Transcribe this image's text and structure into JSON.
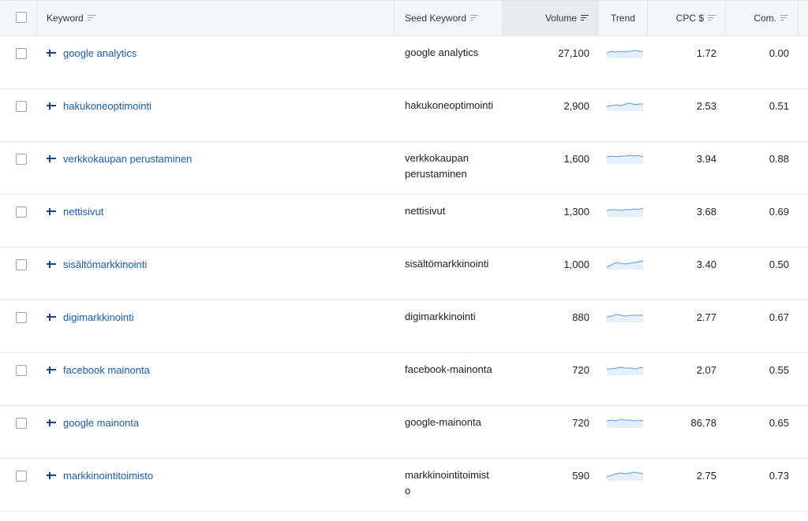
{
  "columns": {
    "keyword": "Keyword",
    "seed": "Seed Keyword",
    "volume": "Volume",
    "trend": "Trend",
    "cpc": "CPC $",
    "com": "Com."
  },
  "rows": [
    {
      "keyword": "google analytics",
      "seed": "google analytics",
      "volume": "27,100",
      "cpc": "1.72",
      "com": "0.00"
    },
    {
      "keyword": "hakukoneoptimointi",
      "seed": "hakukoneoptimointi",
      "volume": "2,900",
      "cpc": "2.53",
      "com": "0.51"
    },
    {
      "keyword": "verkkokaupan perustaminen",
      "seed": "verkkokaupan perustaminen",
      "volume": "1,600",
      "cpc": "3.94",
      "com": "0.88"
    },
    {
      "keyword": "nettisivut",
      "seed": "nettisivut",
      "volume": "1,300",
      "cpc": "3.68",
      "com": "0.69"
    },
    {
      "keyword": "sisältömarkkinointi",
      "seed": "sisältömarkkinointi",
      "volume": "1,000",
      "cpc": "3.40",
      "com": "0.50"
    },
    {
      "keyword": "digimarkkinointi",
      "seed": "digimarkkinointi",
      "volume": "880",
      "cpc": "2.77",
      "com": "0.67"
    },
    {
      "keyword": "facebook mainonta",
      "seed": "facebook-mainonta",
      "volume": "720",
      "cpc": "2.07",
      "com": "0.55"
    },
    {
      "keyword": "google mainonta",
      "seed": "google-mainonta",
      "volume": "720",
      "cpc": "86.78",
      "com": "0.65"
    },
    {
      "keyword": "markkinointitoimisto",
      "seed": "markkinointitoimisto",
      "volume": "590",
      "cpc": "2.75",
      "com": "0.73"
    }
  ],
  "colors": {
    "link": "#1a5bb8",
    "trend_line": "#5a9be6",
    "trend_fill": "#e6f0fc",
    "active_header": "#e9ebee"
  }
}
